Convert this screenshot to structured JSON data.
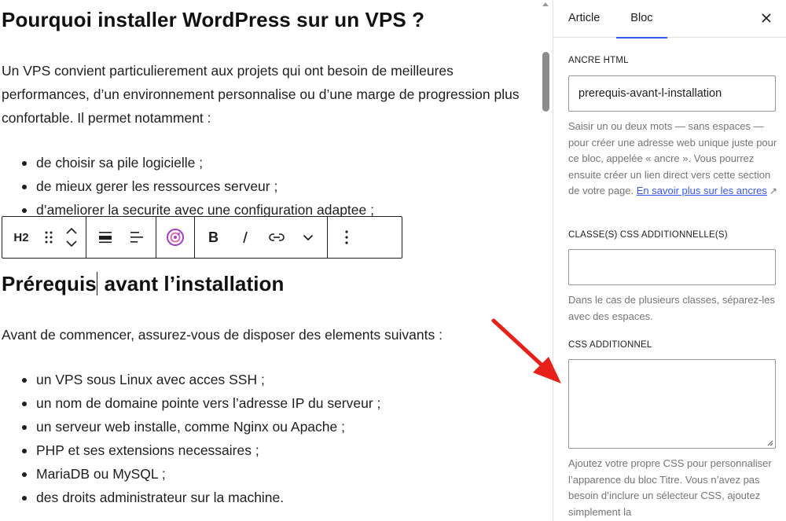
{
  "editor": {
    "heading1": "Pourquoi installer WordPress sur un VPS ?",
    "paragraph1": "Un VPS convient particulierement aux projets qui ont besoin de meilleures performances, d’un environnement personnalise ou d’une marge de progression plus confortable. Il permet notamment :",
    "list1": [
      "de choisir sa pile logicielle ;",
      "de mieux gerer les ressources serveur ;",
      "d’ameliorer la securite avec une configuration adaptee ;"
    ],
    "heading2_before_caret": "Prérequis",
    "heading2_after_caret": " avant l’installation",
    "paragraph2": "Avant de commencer, assurez-vous de disposer des elements suivants :",
    "list2": [
      "un VPS sous Linux avec acces SSH ;",
      "un nom de domaine pointe vers l’adresse IP du serveur ;",
      "un serveur web installe, comme Nginx ou Apache ;",
      "PHP et ses extensions necessaires ;",
      "MariaDB ou MySQL ;",
      "des droits administrateur sur la machine."
    ]
  },
  "toolbar": {
    "block_type_label": "H2",
    "icons": [
      "drag-handle-icon",
      "chevron-up-icon",
      "chevron-down-icon",
      "align-icon",
      "text-align-icon",
      "ai-assistant-icon",
      "bold-icon",
      "italic-icon",
      "link-icon",
      "more-chevron-icon",
      "options-icon"
    ],
    "ai_icon_color": "#a03cc8"
  },
  "sidebar": {
    "tabs": [
      "Article",
      "Bloc"
    ],
    "active_tab": "Bloc",
    "accent_color": "#3858e9",
    "html_anchor": {
      "label": "ANCRE HTML",
      "value": "prerequis-avant-l-installation",
      "help": "Saisir un ou deux mots — sans espaces — pour créer une adresse web unique juste pour ce bloc, appelée « ancre ». Vous pourrez ensuite créer un lien direct vers cette section de votre page. ",
      "link_text": "En savoir plus sur les ancres",
      "link_suffix": "↗"
    },
    "css_classes": {
      "label": "CLASSE(S) CSS ADDITIONNELLE(S)",
      "value": "",
      "help": "Dans le cas de plusieurs classes, séparez-les avec des espaces."
    },
    "additional_css": {
      "label": "CSS ADDITIONNEL",
      "value": "",
      "help": "Ajoutez votre propre CSS pour personnaliser l’apparence du bloc Titre. Vous n’avez pas besoin d’inclure un sélecteur CSS, ajoutez simplement la"
    }
  },
  "annotation": {
    "arrow_color": "#e8201a"
  }
}
